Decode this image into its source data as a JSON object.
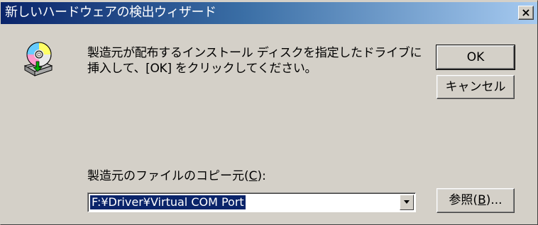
{
  "window": {
    "title": "新しいハードウェアの検出ウィザード",
    "close_glyph": "×"
  },
  "icon": {
    "name": "cd-drive-icon"
  },
  "message": {
    "text": "製造元が配布するインストール ディスクを指定したドライブに挿入して、[OK] をクリックしてください。"
  },
  "buttons": {
    "ok_label": "OK",
    "cancel_label": "キャンセル",
    "browse_prefix": "参照(",
    "browse_accel": "B",
    "browse_suffix": ")..."
  },
  "copy_from": {
    "label_prefix": "製造元のファイルのコピー元(",
    "label_accel": "C",
    "label_suffix": "):",
    "value": "F:¥Driver¥Virtual COM Port"
  },
  "colors": {
    "dialog_bg": "#d4d0c8",
    "title_gradient_start": "#0a246a",
    "title_gradient_end": "#a6caf0",
    "selection": "#0a246a"
  }
}
